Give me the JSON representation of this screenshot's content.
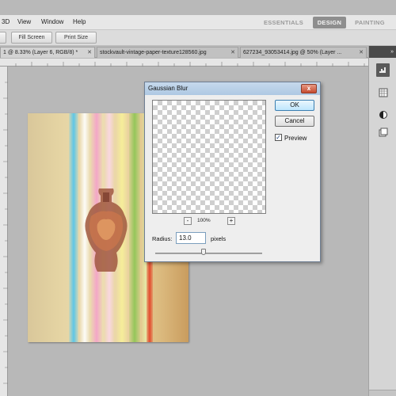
{
  "menubar": {
    "items": [
      "3D",
      "View",
      "Window",
      "Help"
    ],
    "workspaces": [
      {
        "label": "ESSENTIALS",
        "active": false
      },
      {
        "label": "DESIGN",
        "active": true
      },
      {
        "label": "PAINTING",
        "active": false
      }
    ]
  },
  "options_bar": {
    "buttons": [
      "Fill Screen",
      "Print Size"
    ]
  },
  "tabs": [
    {
      "label": "1 @ 8.33% (Layer 6, RGB/8) *",
      "active": true
    },
    {
      "label": "stockvault-vintage-paper-texture128560.jpg",
      "active": false
    },
    {
      "label": "627234_93053414.jpg @ 50% (Layer ...",
      "active": false
    }
  ],
  "right_panel": {
    "collapse_label": "»",
    "icons": [
      "histogram-icon",
      "swatches-icon",
      "adjustments-icon",
      "layers-icon"
    ]
  },
  "dialog": {
    "title": "Gaussian Blur",
    "close_label": "x",
    "ok_label": "OK",
    "cancel_label": "Cancel",
    "preview_label": "Preview",
    "preview_checked": true,
    "zoom_out_label": "-",
    "zoom_in_label": "+",
    "zoom_value": "100%",
    "radius_label": "Radius:",
    "radius_value": "13.0",
    "radius_unit": "pixels",
    "slider_fraction": 0.45
  },
  "colors": {
    "active_workspace": "#8e8e8e",
    "dialog_title_bar": "#aec8e3",
    "default_button": "#bee6fd"
  }
}
